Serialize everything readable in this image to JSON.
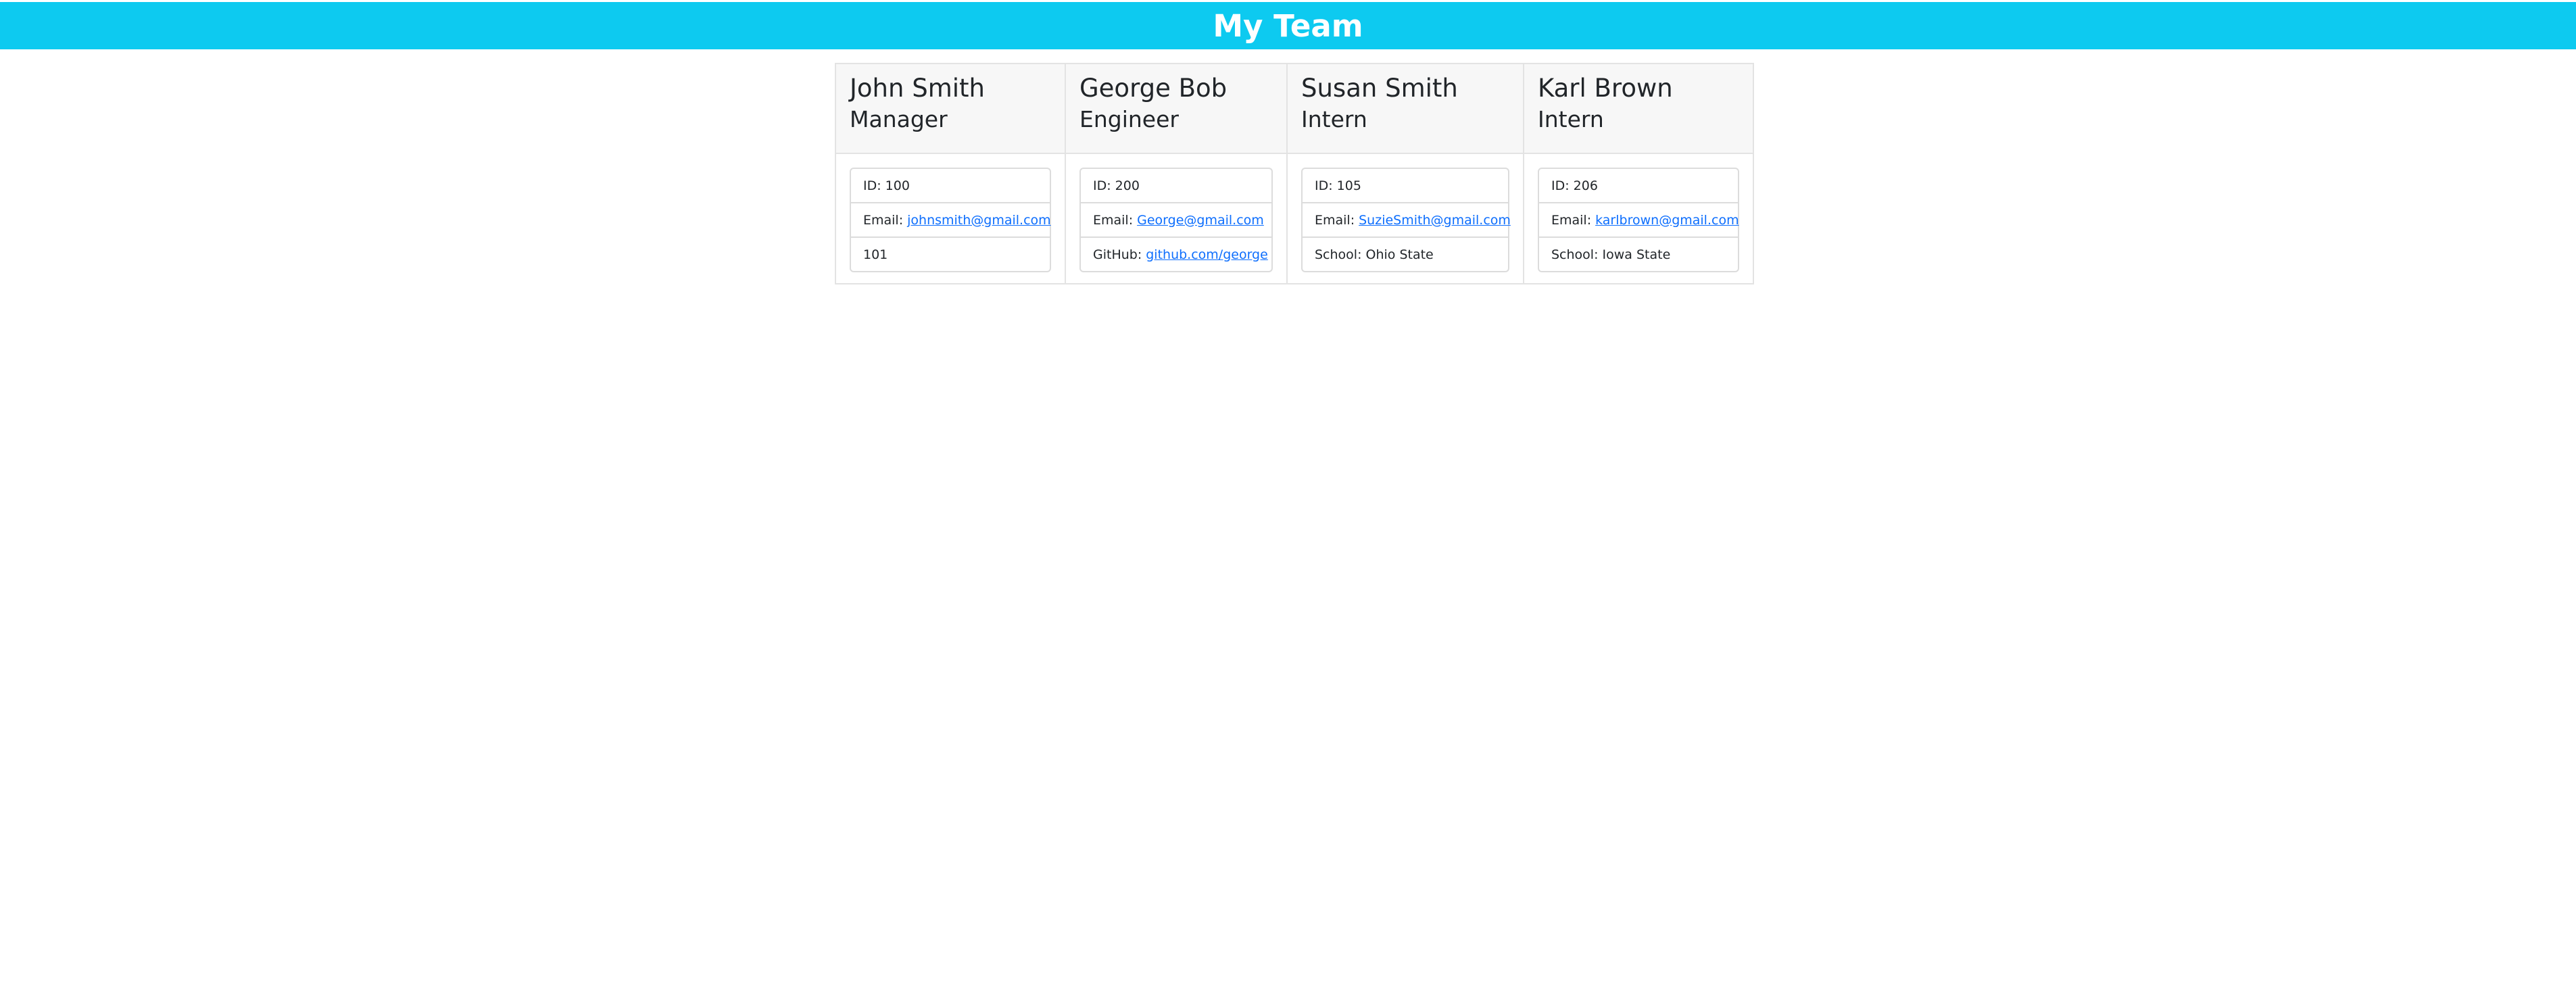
{
  "header": {
    "title": "My Team"
  },
  "team": [
    {
      "name": "John Smith",
      "role": "Manager",
      "id_label": "ID: 100",
      "email_label": "Email:",
      "email": "johnsmith@gmail.com",
      "extra": "101"
    },
    {
      "name": "George Bob",
      "role": "Engineer",
      "id_label": "ID: 200",
      "email_label": "Email:",
      "email": "George@gmail.com",
      "extra_label": "GitHub:",
      "extra_link": "github.com/george"
    },
    {
      "name": "Susan Smith",
      "role": "Intern",
      "id_label": "ID: 105",
      "email_label": "Email:",
      "email": "SuzieSmith@gmail.com",
      "extra": "School: Ohio State"
    },
    {
      "name": "Karl Brown",
      "role": "Intern",
      "id_label": "ID: 206",
      "email_label": "Email:",
      "email": "karlbrown@gmail.com",
      "extra": "School: Iowa State"
    }
  ],
  "colors": {
    "banner": "#0dcaf0",
    "link": "#0d6efd",
    "card_header_bg": "#f7f7f7"
  }
}
